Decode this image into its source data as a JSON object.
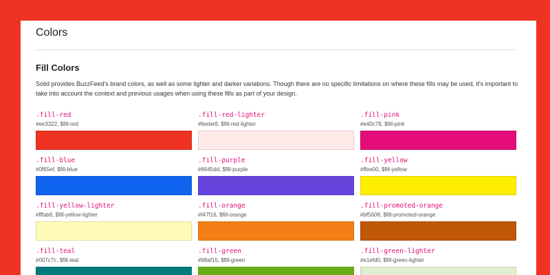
{
  "page": {
    "title": "Colors"
  },
  "section": {
    "title": "Fill Colors",
    "description": "Solid provides BuzzFeed's brand colors, as well as some lighter and darker variations. Though there are no specific limitations on where these fills may be used, it's important to take into account the context and previous usages when using these fills as part of your design."
  },
  "colors": {
    "frame": "#ee3322",
    "class_text": "#e40c78"
  },
  "swatches": [
    {
      "name": ".fill-red",
      "meta": "#ee3322, $fill-red",
      "hex": "#ee3322"
    },
    {
      "name": ".fill-red-lighter",
      "meta": "#feebe9, $fill-red-lighter",
      "hex": "#feebe9"
    },
    {
      "name": ".fill-pink",
      "meta": "#e40c78, $fill-pink",
      "hex": "#e40c78"
    },
    {
      "name": ".fill-blue",
      "meta": "#0f65ef, $fill-blue",
      "hex": "#0f65ef"
    },
    {
      "name": ".fill-purple",
      "meta": "#6645dd, $fill-purple",
      "hex": "#6645dd"
    },
    {
      "name": ".fill-yellow",
      "meta": "#ffee00, $fill-yellow",
      "hex": "#ffee00"
    },
    {
      "name": ".fill-yellow-lighter",
      "meta": "#fffab6, $fill-yellow-lighter",
      "hex": "#fffab6"
    },
    {
      "name": ".fill-orange",
      "meta": "#f47f16, $fill-orange",
      "hex": "#f47f16"
    },
    {
      "name": ".fill-promoted-orange",
      "meta": "#bf5608, $fill-promoted-orange",
      "hex": "#bf5608"
    },
    {
      "name": ".fill-teal",
      "meta": "#007c7c, $fill-teal",
      "hex": "#007c7c"
    },
    {
      "name": ".fill-green",
      "meta": "#68af15, $fill-green",
      "hex": "#68af15"
    },
    {
      "name": ".fill-green-lighter",
      "meta": "#e1efd0, $fill-green-lighter",
      "hex": "#e1efd0"
    }
  ]
}
